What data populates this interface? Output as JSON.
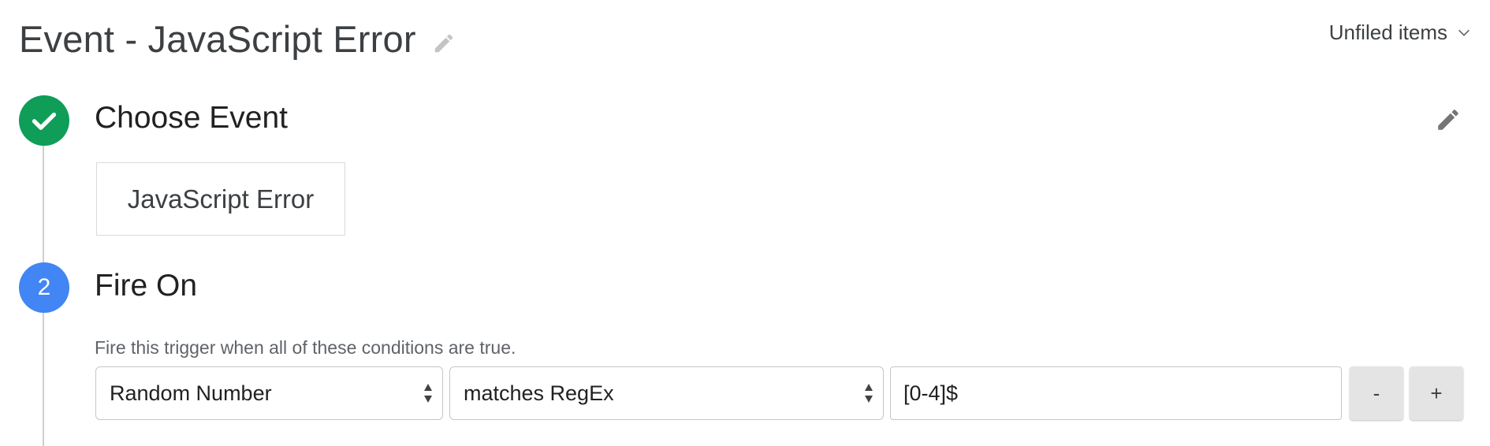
{
  "header": {
    "title": "Event - JavaScript Error",
    "folder_label": "Unfiled items",
    "title_edit_icon": "pencil-icon",
    "folder_dropdown_icon": "chevron-down-icon"
  },
  "steps": [
    {
      "status": "complete",
      "indicator_icon": "check-icon",
      "title": "Choose Event",
      "selected_event": "JavaScript Error",
      "edit_icon": "pencil-icon"
    },
    {
      "status": "active",
      "number": "2",
      "title": "Fire On",
      "description": "Fire this trigger when all of these conditions are true.",
      "condition": {
        "variable": "Random Number",
        "operator": "matches RegEx",
        "value": "[0-4]$"
      },
      "remove_label": "-",
      "add_label": "+"
    }
  ],
  "colors": {
    "complete": "#0f9d58",
    "active": "#4285f4",
    "timeline": "#cfcfcf"
  }
}
